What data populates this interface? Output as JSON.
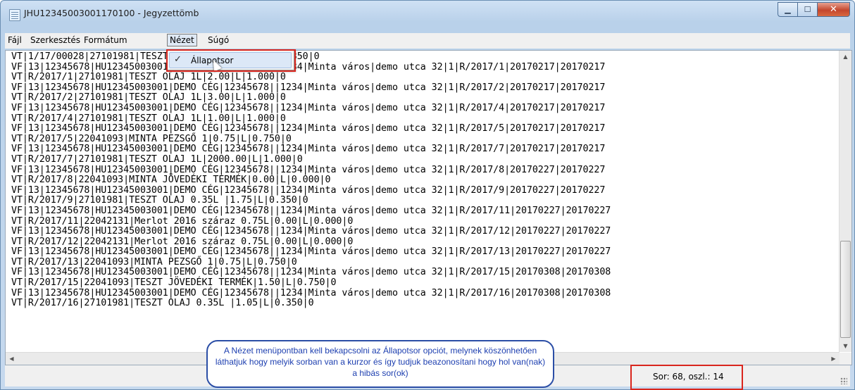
{
  "window": {
    "title": "JHU12345003001170100 - Jegyzettömb"
  },
  "caption_buttons": {
    "minimize": "▁",
    "maximize": "☐",
    "close": "✕"
  },
  "menu": [
    "Fájl",
    "Szerkesztés",
    "Formátum",
    "Nézet",
    "Súgó"
  ],
  "dropdown": {
    "check": "✓",
    "item": "Állapotsor"
  },
  "editor": {
    "lines": [
      "VT|1/17/00028|27101981|TESZT OLAJ 0.35L |1.75|L|0.350|0",
      "VF|13|12345678|HU12345003001|DEMO CÉG|12345678||1234|Minta város|demo utca 32|1|R/2017/1|20170217|20170217",
      "VT|R/2017/1|27101981|TESZT OLAJ 1L|2.00|L|1.000|0",
      "VF|13|12345678|HU12345003001|DEMO CÉG|12345678||1234|Minta város|demo utca 32|1|R/2017/2|20170217|20170217",
      "VT|R/2017/2|27101981|TESZT OLAJ 1L|3.00|L|1.000|0",
      "VF|13|12345678|HU12345003001|DEMO CÉG|12345678||1234|Minta város|demo utca 32|1|R/2017/4|20170217|20170217",
      "VT|R/2017/4|27101981|TESZT OLAJ 1L|1.00|L|1.000|0",
      "VF|13|12345678|HU12345003001|DEMO CÉG|12345678||1234|Minta város|demo utca 32|1|R/2017/5|20170217|20170217",
      "VT|R/2017/5|22041093|MINTA PEZSGŐ 1|0.75|L|0.750|0",
      "VF|13|12345678|HU12345003001|DEMO CÉG|12345678||1234|Minta város|demo utca 32|1|R/2017/7|20170217|20170217",
      "VT|R/2017/7|27101981|TESZT OLAJ 1L|2000.00|L|1.000|0",
      "VF|13|12345678|HU12345003001|DEMO CÉG|12345678||1234|Minta város|demo utca 32|1|R/2017/8|20170227|20170227",
      "VT|R/2017/8|22041093|MINTA JÖVEDÉKI TERMÉK|0.00|L|0.000|0",
      "VF|13|12345678|HU12345003001|DEMO CÉG|12345678||1234|Minta város|demo utca 32|1|R/2017/9|20170227|20170227",
      "VT|R/2017/9|27101981|TESZT OLAJ 0.35L |1.75|L|0.350|0",
      "VF|13|12345678|HU12345003001|DEMO CÉG|12345678||1234|Minta város|demo utca 32|1|R/2017/11|20170227|20170227",
      "VT|R/2017/11|22042131|Merlot 2016 száraz 0.75L|0.00|L|0.000|0",
      "VF|13|12345678|HU12345003001|DEMO CÉG|12345678||1234|Minta város|demo utca 32|1|R/2017/12|20170227|20170227",
      "VT|R/2017/12|22042131|Merlot 2016 száraz 0.75L|0.00|L|0.000|0",
      "VF|13|12345678|HU12345003001|DEMO CÉG|12345678||1234|Minta város|demo utca 32|1|R/2017/13|20170227|20170227",
      "VT|R/2017/13|22041093|MINTA PEZSGŐ 1|0.75|L|0.750|0",
      "VF|13|12345678|HU12345003001|DEMO CÉG|12345678||1234|Minta város|demo utca 32|1|R/2017/15|20170308|20170308",
      "VT|R/2017/15|22041093|TESZT JÖVEDÉKI TERMÉK|1.50|L|0.750|0",
      "VF|13|12345678|HU12345003001|DEMO CÉG|12345678||1234|Minta város|demo utca 32|1|R/2017/16|20170308|20170308",
      "VT|R/2017/16|27101981|TESZT OLAJ 0.35L |1.05|L|0.350|0"
    ]
  },
  "statusbar": {
    "position": "Sor: 68, oszl.: 14"
  },
  "callout": {
    "text": "A Nézet menüpontban kell bekapcsolni az Állapotsor opciót, melynek köszönhetően láthatjuk hogy melyik sorban van a kurzor és így tudjuk beazonosítani hogy hol van(nak) a hibás sor(ok)"
  },
  "colors": {
    "highlight": "#d9251d",
    "callout_border": "#2b4ea6",
    "callout_text": "#1d3fb0"
  }
}
